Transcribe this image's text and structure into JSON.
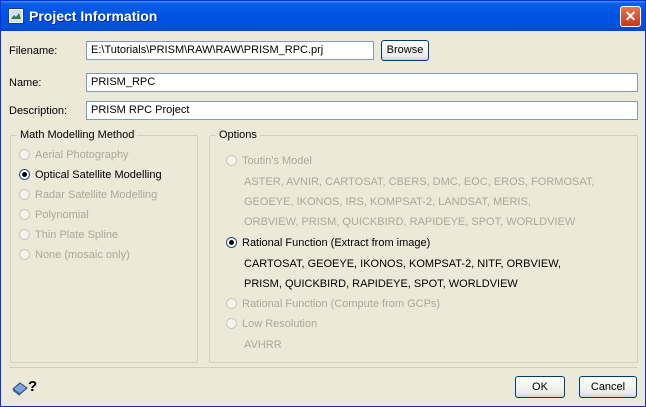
{
  "window": {
    "title": "Project Information"
  },
  "fields": {
    "filename_label": "Filename:",
    "filename_value": "E:\\Tutorials\\PRISM\\RAW\\RAW\\PRISM_RPC.prj",
    "browse_label": "Browse",
    "name_label": "Name:",
    "name_value": "PRISM_RPC",
    "description_label": "Description:",
    "description_value": "PRISM RPC Project"
  },
  "math_group": {
    "title": "Math Modelling Method",
    "options": [
      {
        "label": "Aerial Photography",
        "checked": false,
        "enabled": false
      },
      {
        "label": "Optical Satellite Modelling",
        "checked": true,
        "enabled": true
      },
      {
        "label": "Radar Satellite Modelling",
        "checked": false,
        "enabled": false
      },
      {
        "label": "Polynomial",
        "checked": false,
        "enabled": false
      },
      {
        "label": "Thin Plate Spline",
        "checked": false,
        "enabled": false
      },
      {
        "label": "None (mosaic only)",
        "checked": false,
        "enabled": false
      }
    ]
  },
  "options_group": {
    "title": "Options",
    "toutin": {
      "label": "Toutin's Model",
      "lines": [
        "ASTER, AVNIR, CARTOSAT, CBERS, DMC, EOC, EROS, FORMOSAT,",
        "GEOEYE, IKONOS, IRS, KOMPSAT-2, LANDSAT, MERIS,",
        "ORBVIEW, PRISM, QUICKBIRD, RAPIDEYE, SPOT, WORLDVIEW"
      ]
    },
    "rational_extract": {
      "label": "Rational Function (Extract from image)",
      "lines": [
        "CARTOSAT, GEOEYE, IKONOS, KOMPSAT-2, NITF, ORBVIEW,",
        "PRISM, QUICKBIRD, RAPIDEYE, SPOT, WORLDVIEW"
      ]
    },
    "rational_gcp": {
      "label": "Rational Function (Compute from GCPs)"
    },
    "low_res": {
      "label": "Low Resolution",
      "lines": [
        "AVHRR"
      ]
    }
  },
  "footer": {
    "ok_label": "OK",
    "cancel_label": "Cancel"
  },
  "icons": {
    "title": "app-icon",
    "help": "help-icon",
    "close": "close-icon"
  }
}
